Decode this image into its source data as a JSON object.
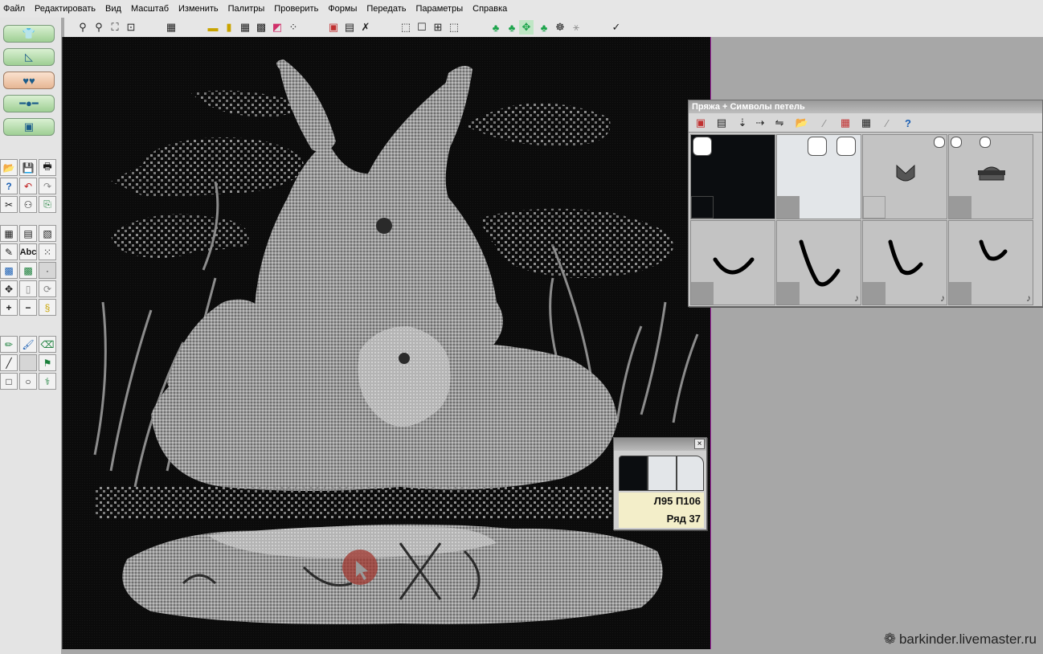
{
  "menu": [
    "Файл",
    "Редактировать",
    "Вид",
    "Масштаб",
    "Изменить",
    "Палитры",
    "Проверить",
    "Формы",
    "Передать",
    "Параметры",
    "Справка"
  ],
  "toolbar": {
    "icons": [
      "zoom-in-icon",
      "zoom-out-icon",
      "zoom-fit-icon",
      "zoom-window-icon",
      "calculator-icon",
      "ruler-h-icon",
      "ruler-v-icon",
      "grid-icon",
      "pattern-icon",
      "color-icon",
      "select-icon",
      "palette-icon",
      "stitch-palette-icon",
      "pattern-edit-icon",
      "lasso-icon",
      "rect-select-icon",
      "marquee-icon",
      "crop-icon",
      "yarn-carrier-icon",
      "machine-icon",
      "move-icon",
      "knit-icon",
      "check-icon"
    ]
  },
  "left_panel": {
    "big_buttons": [
      "sweater-icon",
      "shape-icon",
      "pattern-icon",
      "carriage-icon",
      "knitting-machine-icon"
    ],
    "text_tool": "Abc"
  },
  "yarn_panel": {
    "title": "Пряжа + Символы петель",
    "colors": {
      "black": "#0b0d10",
      "white": "#e3e6e9",
      "gray": "#c3c3c3"
    },
    "note_symbol": "♪"
  },
  "info_window": {
    "close": "×",
    "position": "Л95 П106",
    "row": "Ряд 37"
  },
  "watermark": "barkinder.livemaster.ru"
}
